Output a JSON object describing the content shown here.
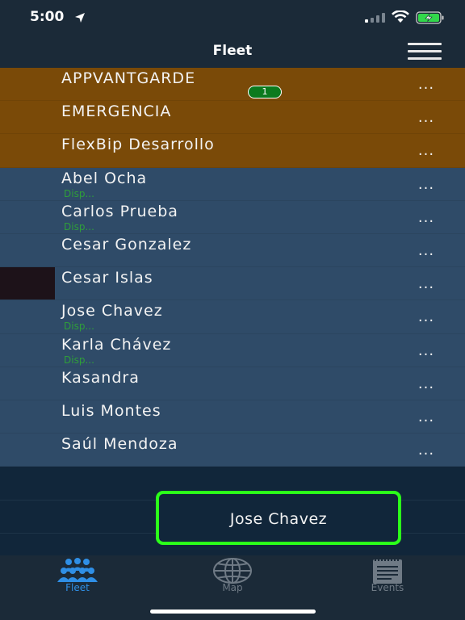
{
  "status_bar": {
    "time": "5:00"
  },
  "nav": {
    "title": "Fleet"
  },
  "groups": [
    {
      "name": "APPVANTGARDE",
      "badge": "1",
      "more": "..."
    },
    {
      "name": "EMERGENCIA",
      "more": "..."
    },
    {
      "name": "FlexBip Desarrollo",
      "more": "..."
    }
  ],
  "units": [
    {
      "name": "Abel Ocha",
      "status": "Disp...",
      "more": "..."
    },
    {
      "name": "Carlos Prueba",
      "status": "Disp...",
      "more": "..."
    },
    {
      "name": "Cesar Gonzalez",
      "more": "..."
    },
    {
      "name": "Cesar Islas",
      "more": "..."
    },
    {
      "name": "Jose Chavez",
      "status": "Disp...",
      "more": "..."
    },
    {
      "name": "Karla Chávez",
      "status": "Disp...",
      "more": "..."
    },
    {
      "name": "Kasandra",
      "more": "..."
    },
    {
      "name": "Luis Montes",
      "more": "..."
    },
    {
      "name": "Saúl Mendoza",
      "more": "..."
    }
  ],
  "selected_unit": {
    "label": "Jose Chavez"
  },
  "tabs": [
    {
      "label": "Fleet",
      "icon": "group-icon",
      "active": true
    },
    {
      "label": "Map",
      "icon": "globe-icon",
      "active": false
    },
    {
      "label": "Events",
      "icon": "notepad-icon",
      "active": false
    }
  ],
  "colors": {
    "group_row": "#7a4a08",
    "unit_row": "#2f4b68",
    "badge": "#0b7a1e",
    "status_text": "#2f9e3a",
    "selection_border": "#2bff1a",
    "tab_active": "#2f8fe6",
    "tab_inactive": "#6f7a85"
  }
}
